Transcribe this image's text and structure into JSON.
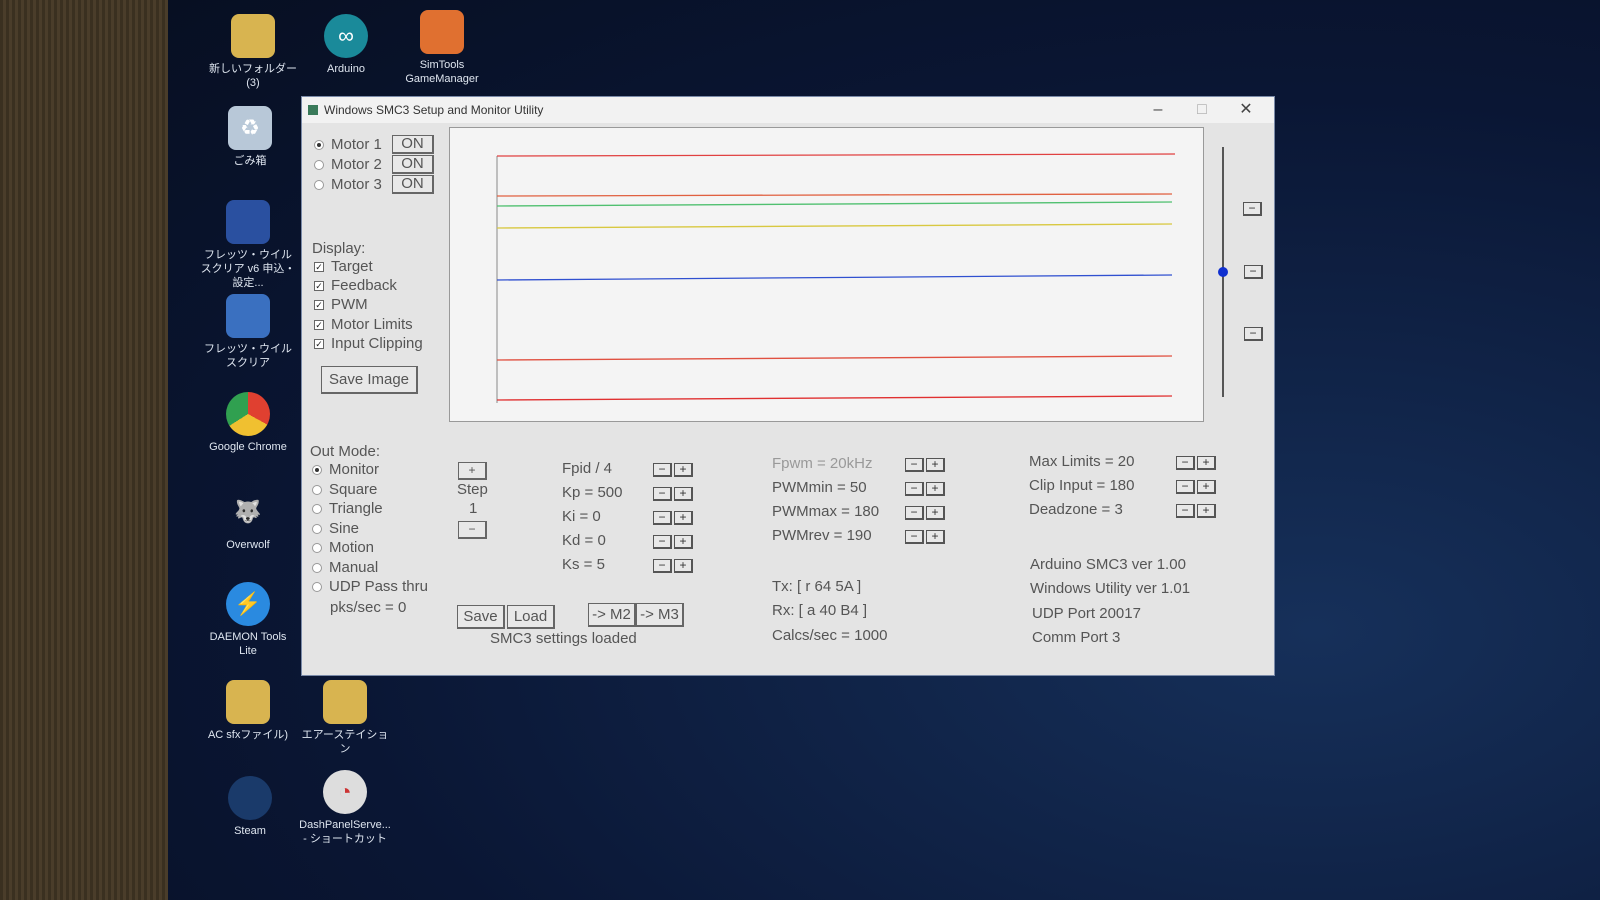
{
  "desktop": {
    "icons": [
      {
        "label": "新しいフォルダー (3)",
        "icon": "folder-icon"
      },
      {
        "label": "Arduino",
        "icon": "arduino-icon"
      },
      {
        "label": "SimTools GameManager",
        "icon": "simtools-icon"
      },
      {
        "label": "ごみ箱",
        "icon": "recycle-bin-icon"
      },
      {
        "label": "フレッツ・ウイルスクリア v6 申込・設定...",
        "icon": "shield-icon"
      },
      {
        "label": "フレッツ・ウイルスクリア",
        "icon": "virus-clear-icon"
      },
      {
        "label": "Google Chrome",
        "icon": "chrome-icon"
      },
      {
        "label": "Overwolf",
        "icon": "overwolf-icon"
      },
      {
        "label": "DAEMON Tools Lite",
        "icon": "daemon-tools-icon"
      },
      {
        "label": "AC sfxファイル)",
        "icon": "folder-icon"
      },
      {
        "label": "エアーステイション",
        "icon": "folder-icon"
      },
      {
        "label": "Steam",
        "icon": "steam-icon"
      },
      {
        "label": "DashPanelServe... - ショートカット",
        "icon": "gauge-icon"
      }
    ]
  },
  "window": {
    "title": "Windows SMC3 Setup and Monitor Utility",
    "minimize": "–",
    "maximize": "□",
    "close": "✕"
  },
  "motors": [
    {
      "label": "Motor 1",
      "button": "ON",
      "selected": true
    },
    {
      "label": "Motor 2",
      "button": "ON",
      "selected": false
    },
    {
      "label": "Motor 3",
      "button": "ON",
      "selected": false
    }
  ],
  "display": {
    "label": "Display:",
    "items": [
      {
        "label": "Target",
        "checked": true
      },
      {
        "label": "Feedback",
        "checked": true
      },
      {
        "label": "PWM",
        "checked": true
      },
      {
        "label": "Motor Limits",
        "checked": true
      },
      {
        "label": "Input Clipping",
        "checked": true
      }
    ],
    "save_image": "Save Image"
  },
  "plot": {
    "trace_colors": [
      "#e04040",
      "#e06040",
      "#50c070",
      "#d8c840",
      "#3050d0",
      "#e05040",
      "#e03030"
    ]
  },
  "out_mode": {
    "label": "Out Mode:",
    "options": [
      {
        "label": "Monitor",
        "selected": true
      },
      {
        "label": "Square"
      },
      {
        "label": "Triangle"
      },
      {
        "label": "Sine"
      },
      {
        "label": "Motion"
      },
      {
        "label": "Manual"
      },
      {
        "label": "UDP Pass thru"
      }
    ],
    "pks": "pks/sec = 0"
  },
  "step": {
    "plus": "+",
    "label": "Step",
    "value": "1",
    "minus": "−"
  },
  "pid": [
    "Fpid / 4",
    "Kp = 500",
    "Ki = 0",
    "Kd = 0",
    "Ks = 5"
  ],
  "pwm": [
    "Fpwm = 20kHz",
    "PWMmin = 50",
    "PWMmax = 180",
    "PWMrev = 190"
  ],
  "limits": [
    "Max Limits = 20",
    "Clip Input = 180",
    "Deadzone = 3"
  ],
  "comm": {
    "tx": "Tx: [ r 64 5A ]",
    "rx": "Rx: [ a 40 B4 ]",
    "calcs": "Calcs/sec = 1000"
  },
  "info": [
    "Arduino SMC3 ver 1.00",
    "Windows Utility ver 1.01",
    "UDP Port 20017",
    "Comm Port 3"
  ],
  "buttons": {
    "save": "Save",
    "load": "Load",
    "to_m2": "-> M2",
    "to_m3": "-> M3",
    "status": "SMC3 settings loaded",
    "minus": "−",
    "plus": "+"
  }
}
